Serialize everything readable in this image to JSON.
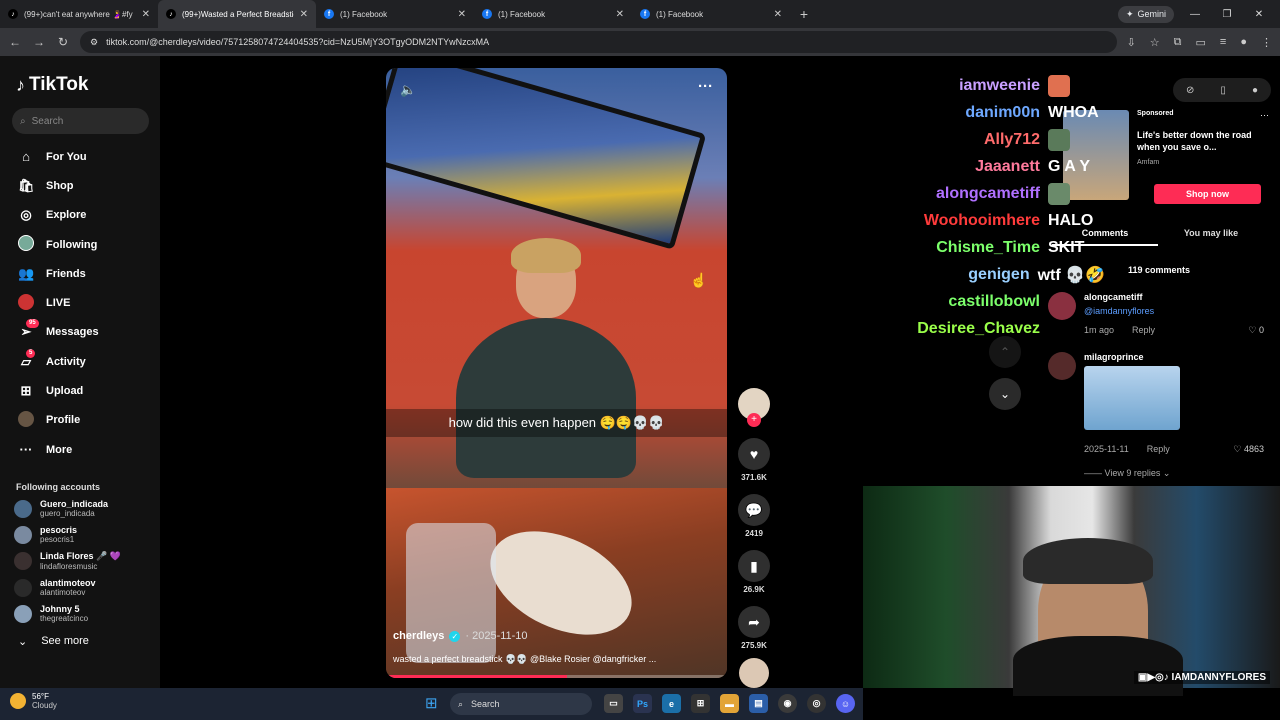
{
  "browser": {
    "tabs": [
      {
        "title": "(99+)can't eat anywhere 🤰#fy",
        "icon": "tiktok-icon"
      },
      {
        "title": "(99+)Wasted a Perfect Breadstick",
        "icon": "tiktok-icon"
      },
      {
        "title": "(1) Facebook",
        "icon": "facebook-icon"
      },
      {
        "title": "(1) Facebook",
        "icon": "facebook-icon"
      },
      {
        "title": "(1) Facebook",
        "icon": "facebook-icon"
      }
    ],
    "gemini_label": "Gemini",
    "url": "tiktok.com/@cherdleys/video/7571258074724404535?cid=NzU5MjY3OTgyODM2NTYwNzcxMA"
  },
  "sidebar": {
    "logo": "TikTok",
    "search_placeholder": "Search",
    "nav": [
      {
        "label": "For You",
        "icon": "home-icon"
      },
      {
        "label": "Shop",
        "icon": "shop-icon"
      },
      {
        "label": "Explore",
        "icon": "compass-icon"
      },
      {
        "label": "Following",
        "icon": "following-avatar"
      },
      {
        "label": "Friends",
        "icon": "friends-icon"
      },
      {
        "label": "LIVE",
        "icon": "live-icon"
      },
      {
        "label": "Messages",
        "icon": "messages-icon",
        "badge": "95"
      },
      {
        "label": "Activity",
        "icon": "activity-icon",
        "badge": "5"
      },
      {
        "label": "Upload",
        "icon": "upload-icon"
      },
      {
        "label": "Profile",
        "icon": "profile-avatar"
      },
      {
        "label": "More",
        "icon": "more-icon"
      }
    ],
    "following_title": "Following accounts",
    "accounts": [
      {
        "name": "Guero_indicada",
        "handle": "guero_indicada"
      },
      {
        "name": "pesocris",
        "handle": "pesocris1"
      },
      {
        "name": "Linda Flores 🎤 💜",
        "handle": "lindafloresmusic"
      },
      {
        "name": "alantimoteov",
        "handle": "alantimoteov"
      },
      {
        "name": "Johnny 5",
        "handle": "thegreatcinco"
      }
    ],
    "see_more": "See more"
  },
  "video": {
    "caption": "how did this even happen 🤤🤤💀💀",
    "author": "cherdleys",
    "date": "· 2025-11-10",
    "description": "wasted a perfect breadstick 💀💀 @Blake Rosier @dangfricker ...",
    "progress": 0.53
  },
  "actions": {
    "likes": "371.6K",
    "comments": "2419",
    "saves": "26.9K",
    "shares": "275.9K"
  },
  "chat": [
    {
      "user": "iamweenie",
      "msg": "",
      "color": "#c9a0ff"
    },
    {
      "user": "danim00n",
      "msg": "WHOA",
      "color": "#6ea8ff"
    },
    {
      "user": "Ally712",
      "msg": "",
      "color": "#ff6b6b"
    },
    {
      "user": "Jaaanett",
      "msg": "G A Y",
      "color": "#ff7a9c"
    },
    {
      "user": "alongcametiff",
      "msg": "",
      "color": "#b070ff"
    },
    {
      "user": "Woohooimhere",
      "msg": "HALO",
      "color": "#ff3b3b"
    },
    {
      "user": "Chisme_Time",
      "msg": "SKIT",
      "color": "#7cff6b"
    },
    {
      "user": "genigen",
      "msg": "wtf 💀🤣",
      "color": "#9ad0ff"
    },
    {
      "user": "castillobowl",
      "msg": "",
      "color": "#7cff6b"
    },
    {
      "user": "Desiree_Chavez",
      "msg": "",
      "color": "#9aff4a"
    }
  ],
  "ad": {
    "sponsored": "Sponsored",
    "title": "Life's better down the road when you save o...",
    "brand": "Amfam",
    "cta": "Shop now"
  },
  "comments": {
    "tab_comments": "Comments",
    "tab_like": "You may like",
    "count": "119 comments",
    "list": [
      {
        "user": "alongcametiff",
        "text": "@iamdannyflores",
        "time": "1m ago",
        "reply": "Reply",
        "likes": "0"
      },
      {
        "user": "milagroprince",
        "text": "",
        "time": "2025-11-11",
        "reply": "Reply",
        "likes": "4863"
      }
    ],
    "view_replies": "View 9 replies"
  },
  "webcam": {
    "handle": "IAMDANNYFLORES"
  },
  "taskbar": {
    "temp": "56°F",
    "condition": "Cloudy",
    "search": "Search"
  }
}
